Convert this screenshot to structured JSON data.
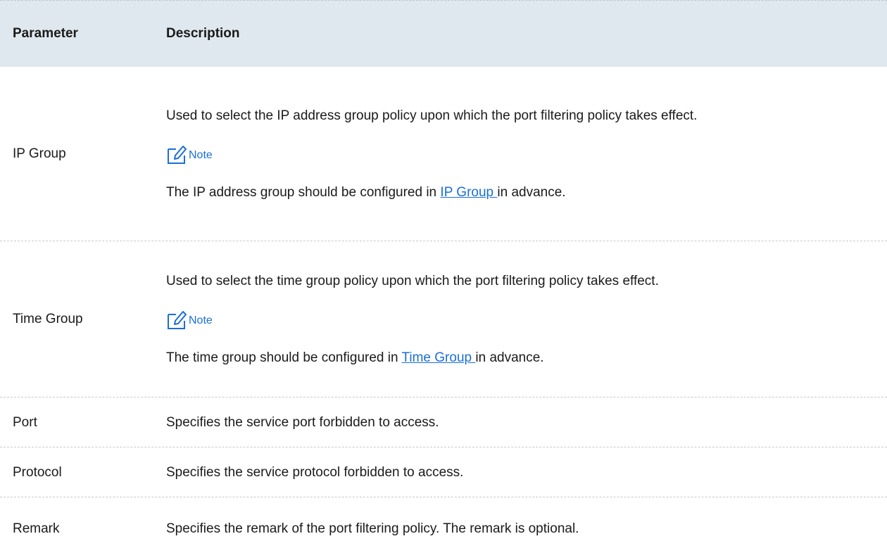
{
  "header": {
    "parameter": "Parameter",
    "description": "Description"
  },
  "rows": [
    {
      "name": "IP Group",
      "description": "Used to select the IP address group policy upon which the port filtering policy takes effect.",
      "note_label": "Note",
      "note_prefix": "The IP address group should be configured in ",
      "note_link": "IP Group ",
      "note_suffix": "in advance."
    },
    {
      "name": "Time Group",
      "description": "Used to select the time group policy upon which the port filtering policy takes effect.",
      "note_label": "Note",
      "note_prefix": "The time group should be configured in ",
      "note_link": "Time Group ",
      "note_suffix": "in advance."
    },
    {
      "name": "Port",
      "description": "Specifies the service port forbidden to access."
    },
    {
      "name": "Protocol",
      "description": "Specifies the service protocol forbidden to access."
    },
    {
      "name": "Remark",
      "description": "Specifies the remark of the port filtering policy. The remark is optional."
    }
  ],
  "colors": {
    "header_bg": "#dfe8ee",
    "accent": "#1a6fd6"
  },
  "icons": {
    "note": "note-edit-icon"
  }
}
